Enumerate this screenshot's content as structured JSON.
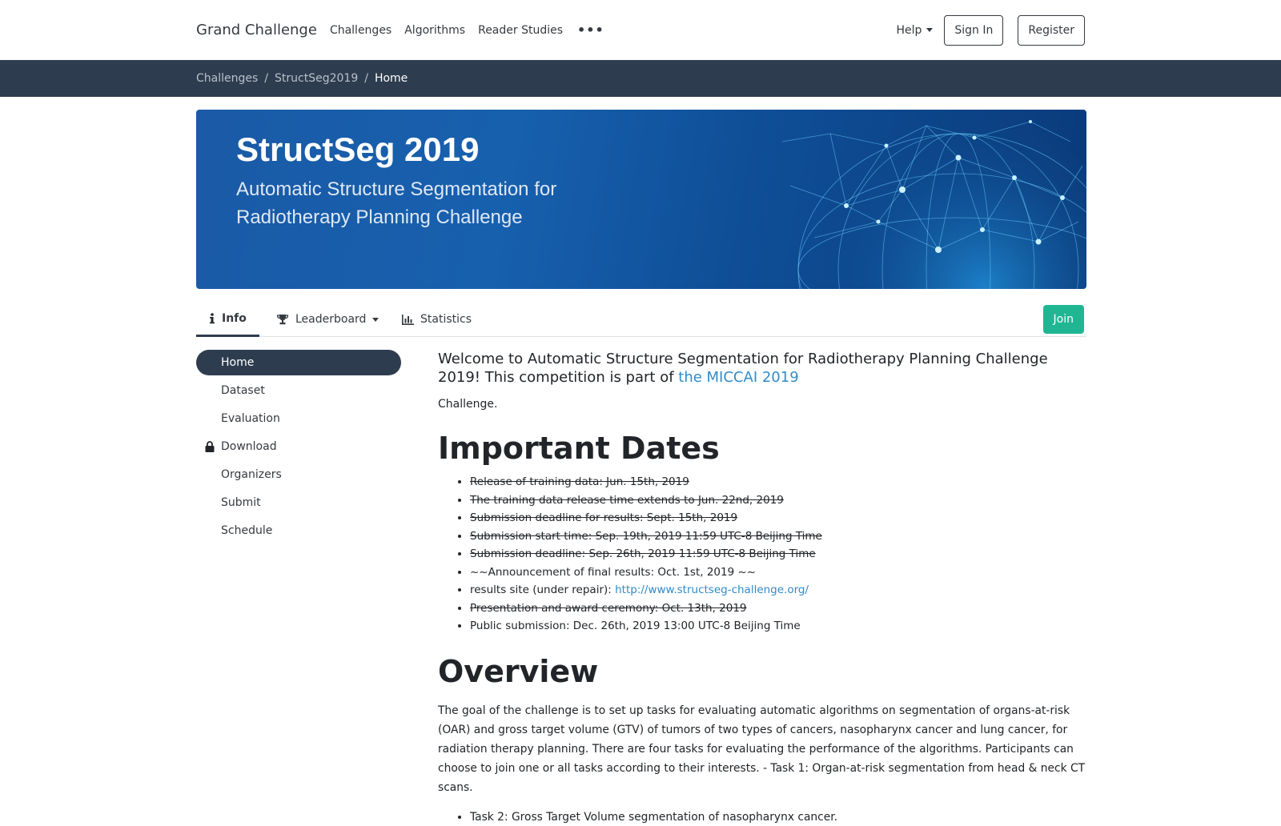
{
  "nav": {
    "brand": "Grand Challenge",
    "links": [
      "Challenges",
      "Algorithms",
      "Reader Studies"
    ],
    "more": "•••",
    "help": "Help",
    "sign_in": "Sign In",
    "register": "Register"
  },
  "breadcrumb": {
    "items": [
      "Challenges",
      "StructSeg2019"
    ],
    "separator": "/",
    "active": "Home"
  },
  "banner": {
    "title": "StructSeg 2019",
    "subtitle": "Automatic Structure Segmentation for Radiotherapy Planning Challenge"
  },
  "tabs": {
    "info": "Info",
    "leaderboard": "Leaderboard",
    "statistics": "Statistics",
    "join": "Join"
  },
  "sidebar": {
    "items": [
      {
        "label": "Home",
        "active": true
      },
      {
        "label": "Dataset"
      },
      {
        "label": "Evaluation"
      },
      {
        "label": "Download",
        "locked": true
      },
      {
        "label": "Organizers"
      },
      {
        "label": "Submit"
      },
      {
        "label": "Schedule"
      }
    ]
  },
  "content": {
    "welcome_prefix": "Welcome to Automatic Structure Segmentation for Radiotherapy Planning Challenge 2019!  This competition is part of ",
    "welcome_link": "the MICCAI 2019",
    "challenge": "Challenge.",
    "dates_heading": "Important Dates",
    "dates": [
      {
        "text": "Release of training data: Jun. 15th, 2019",
        "struck": true
      },
      {
        "text": "The training data release time extends to Jun. 22nd, 2019",
        "struck": true
      },
      {
        "text": "Submission deadline for results: Sept. 15th, 2019",
        "struck": true
      },
      {
        "text": "Submission start time: Sep. 19th, 2019 11:59 UTC-8 Beijing Time",
        "struck": true
      },
      {
        "text": "Submission deadline: Sep. 26th, 2019 11:59 UTC-8 Beijing Time",
        "struck": true
      },
      {
        "text": "~~Announcement of final results: Oct. 1st, 2019 ~~",
        "struck": false
      },
      {
        "text": "results site (under repair): ",
        "link": "http://www.structseg-challenge.org/",
        "struck": false
      },
      {
        "text": "Presentation and award ceremony: Oct. 13th, 2019",
        "struck": true
      },
      {
        "text": "Public submission: Dec. 26th, 2019 13:00 UTC-8 Beijing Time",
        "struck": false
      }
    ],
    "overview_heading": "Overview",
    "overview": "The goal of the challenge is to set up tasks for evaluating automatic algorithms on segmentation of organs-at-risk (OAR) and gross target volume (GTV) of tumors of two types of cancers, nasopharynx cancer and lung cancer, for radiation therapy planning. There are four tasks for evaluating the performance of the algorithms. Participants can choose to join one or all tasks according to their interests.  - Task 1: Organ-at-risk segmentation from head & neck CT scans.",
    "tasks": [
      "Task 2: Gross Target Volume segmentation of nasopharynx cancer."
    ]
  },
  "colors": {
    "dark_nav": "#2e3c4f",
    "join_green": "#20b693",
    "link_blue": "#2f8bc9",
    "banner_blue": "#1760ae"
  }
}
